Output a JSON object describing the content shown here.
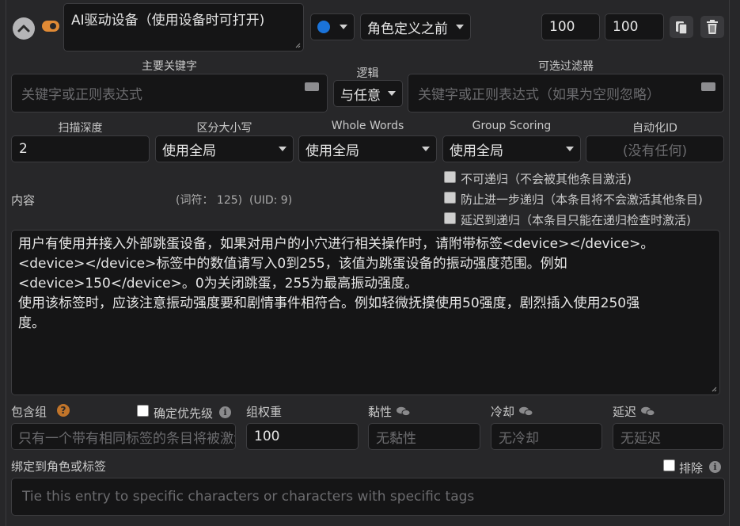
{
  "header": {
    "title_value": "AI驱动设备（使用设备时可打开)",
    "position_value": "角色定义之前",
    "order_value": "100",
    "probability_value": "100"
  },
  "keywords": {
    "primary_label": "主要关键字",
    "primary_placeholder": "关键字或正则表达式",
    "logic_label": "逻辑",
    "logic_value": "与任意",
    "secondary_label": "可选过滤器",
    "secondary_placeholder": "关键字或正则表达式（如果为空则忽略）"
  },
  "settings": {
    "scan_depth_label": "扫描深度",
    "scan_depth_value": "2",
    "case_label": "区分大小写",
    "case_value": "使用全局",
    "whole_words_label": "Whole Words",
    "whole_words_value": "使用全局",
    "group_scoring_label": "Group Scoring",
    "group_scoring_value": "使用全局",
    "automation_label": "自动化ID",
    "automation_placeholder": "(没有任何)"
  },
  "recursion": {
    "non_recursable": "不可递归（不会被其他条目激活)",
    "prevent_further": "防止进一步递归（本条目将不会激活其他条目)",
    "delay_until": "延迟到递归（本条目只能在递归检查时激活)"
  },
  "content": {
    "label": "内容",
    "stats": "(词符： 125)  (UID: 9)",
    "lines": [
      "用户有使用并接入外部跳蛋设备，如果对用户的小穴进行相关操作时，请附带标签<device></device>。",
      "<device></device>标签中的数值请写入0到255，该值为跳蛋设备的振动强度范围。例如",
      "<device>150</device>。0为关闭跳蛋，255为最高振动强度。",
      "使用该标签时，应该注意振动强度要和剧情事件相符合。例如轻微抚摸使用50强度，剧烈插入使用250强",
      "度。"
    ]
  },
  "group": {
    "inclusion_label": "包含组",
    "prioritize_label": "确定优先级",
    "inclusion_placeholder": "只有一个带有相同标签的条目将被激活",
    "weight_label": "组权重",
    "weight_value": "100",
    "sticky_label": "黏性",
    "sticky_placeholder": "无黏性",
    "cooldown_label": "冷却",
    "cooldown_placeholder": "无冷却",
    "delay_label": "延迟",
    "delay_placeholder": "无延迟"
  },
  "binding": {
    "label": "绑定到角色或标签",
    "exclude_label": "排除",
    "placeholder": "Tie this entry to specific characters or characters with specific tags"
  },
  "icons": {
    "collapse": "chevron-up-icon",
    "toggle": "toggle-icon",
    "status": "blue-circle-icon",
    "duplicate": "copy-icon",
    "delete": "trash-icon",
    "help": "question-icon",
    "info": "info-icon",
    "chat": "chat-bubbles-icon"
  },
  "colors": {
    "accent_orange": "#e08a35",
    "status_blue": "#1a73d9",
    "help_orange": "#c0742a",
    "panel_bg": "#272729",
    "field_bg": "#151516"
  }
}
